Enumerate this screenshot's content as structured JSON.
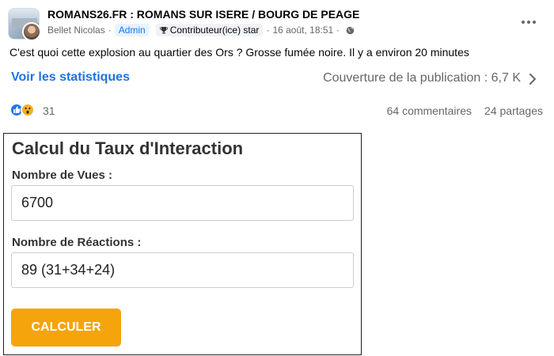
{
  "post": {
    "group_name": "ROMANS26.FR : ROMANS SUR ISERE / BOURG DE PEAGE",
    "author": "Bellet Nicolas",
    "admin_badge": "Admin",
    "contributor_badge": "Contributeur(ice) star",
    "timestamp": "16 août, 18:51",
    "text": "C'est quoi cette explosion au quartier des Ors ? Grosse fumée noire. Il y a environ 20 minutes"
  },
  "stats": {
    "link_label": "Voir les statistiques",
    "reach_label": "Couverture de la publication : 6,7 K"
  },
  "reactions": {
    "count": "31",
    "comments": "64 commentaires",
    "shares": "24 partages",
    "icons": [
      "like-icon",
      "wow-icon"
    ]
  },
  "calculator": {
    "title": "Calcul du Taux d'Interaction",
    "views_label": "Nombre de Vues :",
    "views_value": "6700",
    "reactions_label": "Nombre de Réactions :",
    "reactions_value": "89 (31+34+24)",
    "button_label": "CALCULER"
  },
  "colors": {
    "link_blue": "#1b74e4",
    "button_orange": "#f5a40c",
    "like_blue": "#1877f2",
    "wow_yellow": "#f7b125"
  }
}
